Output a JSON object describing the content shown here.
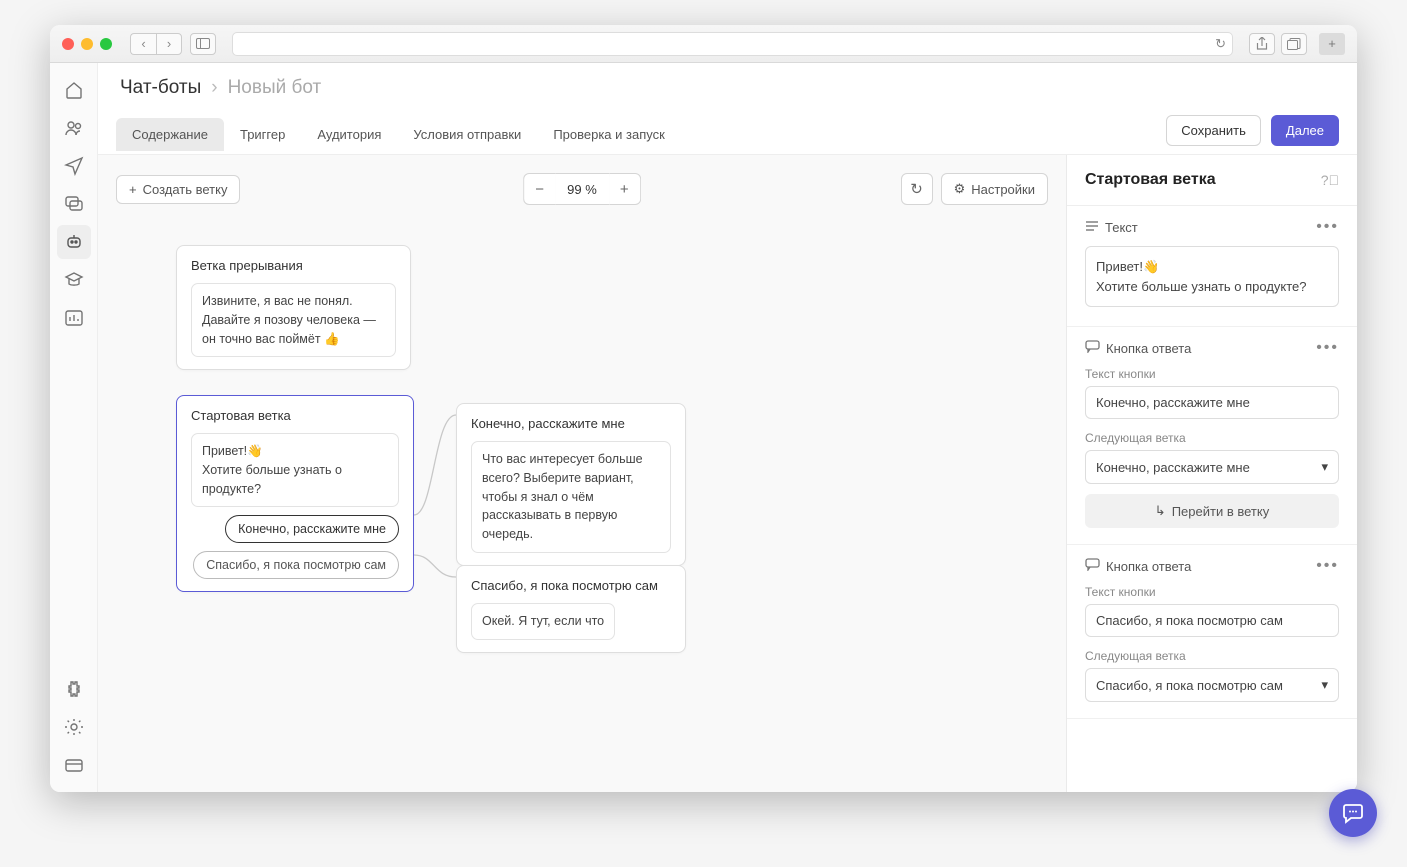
{
  "breadcrumb": {
    "root": "Чат-боты",
    "current": "Новый бот"
  },
  "tabs": {
    "content": "Содержание",
    "trigger": "Триггер",
    "audience": "Аудитория",
    "conditions": "Условия отправки",
    "review": "Проверка и запуск"
  },
  "buttons": {
    "save": "Сохранить",
    "next": "Далее",
    "create_branch": "Создать ветку",
    "settings": "Настройки",
    "go_to_branch": "Перейти в ветку"
  },
  "zoom": "99 %",
  "nodes": {
    "interrupt": {
      "title": "Ветка прерывания",
      "text": "Извините, я вас не понял. Давайте я позову человека — он точно вас поймёт 👍"
    },
    "start": {
      "title": "Стартовая ветка",
      "text": "Привет!👋\nХотите больше узнать о продукте?",
      "reply1": "Конечно, расскажите мне",
      "reply2": "Спасибо, я пока посмотрю сам"
    },
    "branch_yes": {
      "title": "Конечно, расскажите мне",
      "text": "Что вас интересует больше всего? Выберите вариант, чтобы я знал о чём рассказывать в первую очередь."
    },
    "branch_no": {
      "title": "Спасибо, я пока посмотрю сам",
      "text": "Окей. Я тут, если что"
    }
  },
  "props": {
    "panel_title": "Стартовая ветка",
    "text_label": "Текст",
    "text_value": "Привет!👋\nХотите больше узнать о продукте?",
    "reply_label": "Кнопка ответа",
    "button_text_label": "Текст кнопки",
    "next_branch_label": "Следующая ветка",
    "reply1_text": "Конечно, расскажите мне",
    "reply1_next": "Конечно, расскажите мне",
    "reply2_text": "Спасибо, я пока посмотрю сам",
    "reply2_next": "Спасибо, я пока посмотрю сам"
  }
}
